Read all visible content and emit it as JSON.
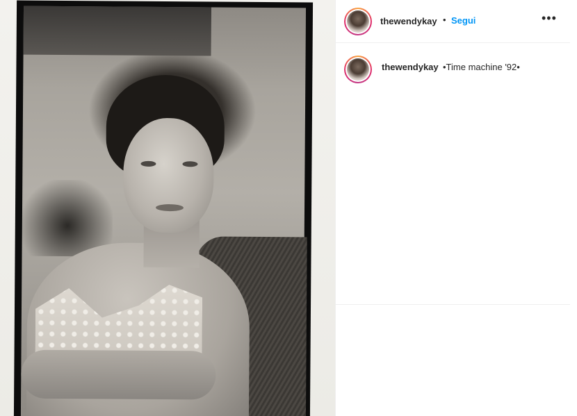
{
  "post": {
    "author": {
      "username": "thewendykay",
      "avatar_icon": "profile-photo"
    },
    "header": {
      "separator": "•",
      "follow_label": "Segui",
      "more_icon": "ellipsis-horizontal-icon",
      "more_label": "•••"
    },
    "caption": {
      "username": "thewendykay",
      "text": "•Time machine '92•"
    }
  },
  "colors": {
    "link_blue": "#0095f6",
    "text": "#262626",
    "story_ring": [
      "#f9a13a",
      "#e1306c",
      "#c13584"
    ]
  }
}
